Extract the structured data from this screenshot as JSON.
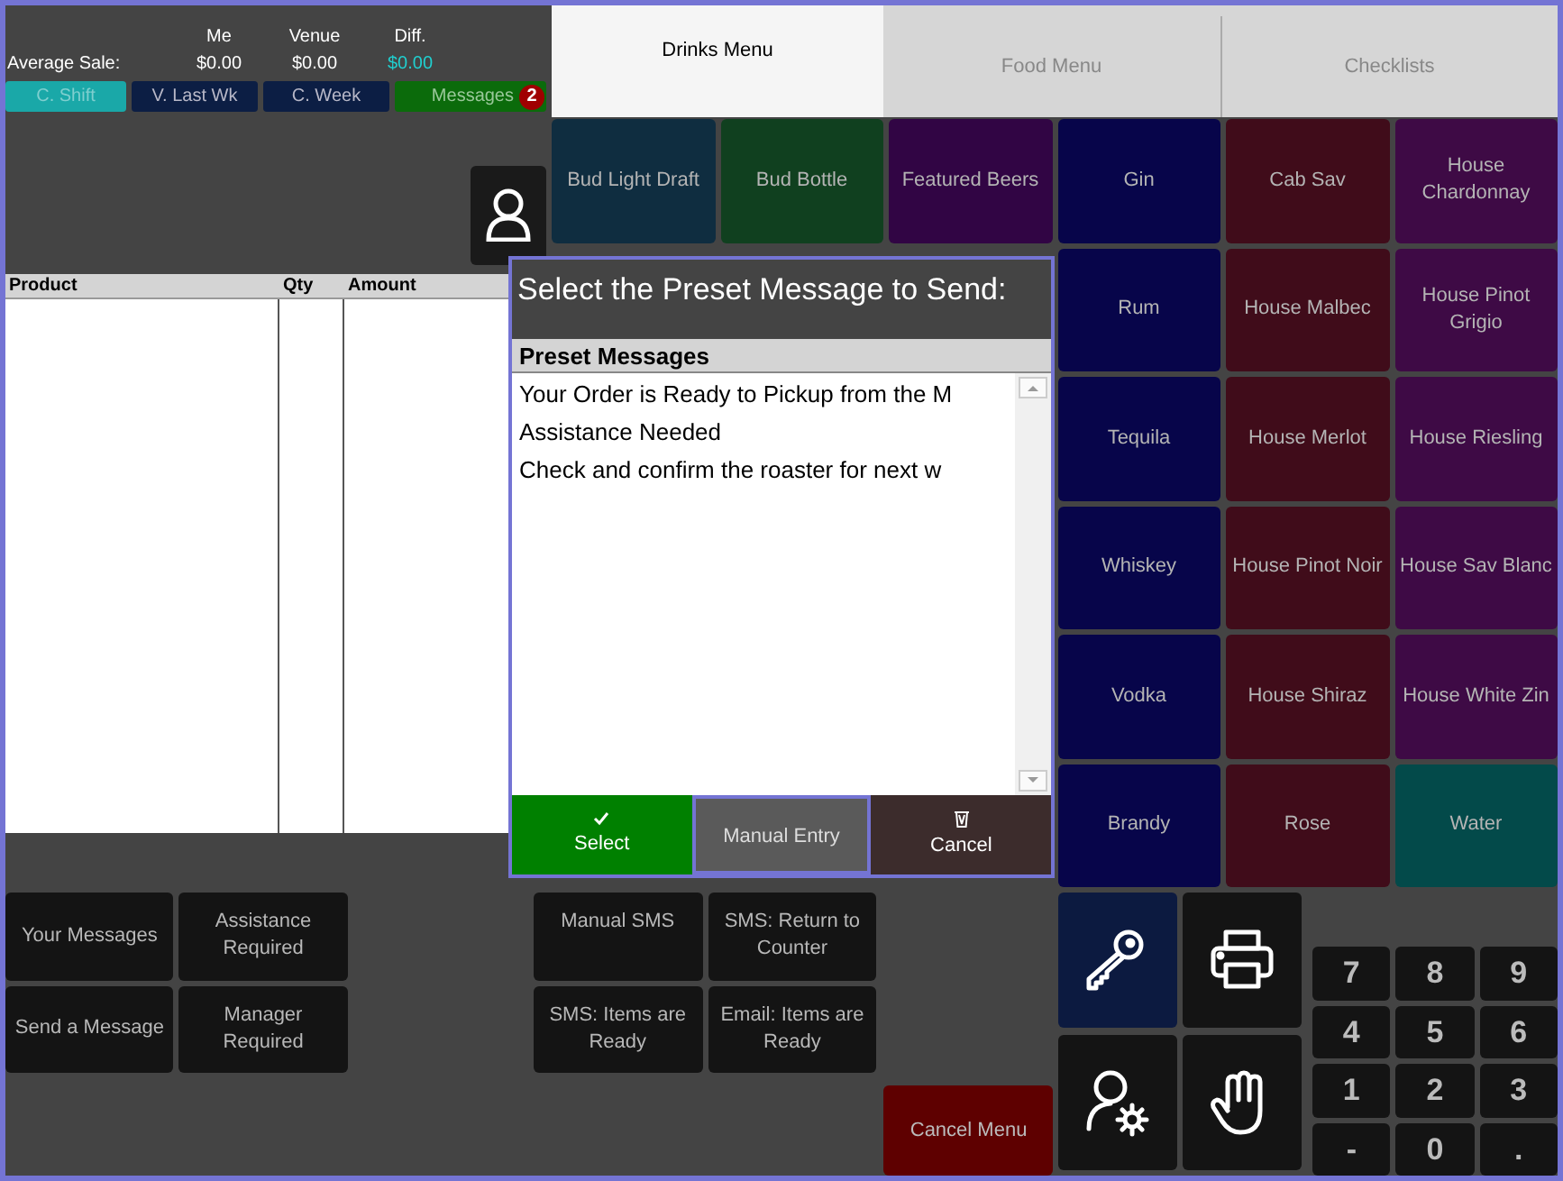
{
  "stats": {
    "label": "Average Sale:",
    "columns": [
      {
        "label": "Me",
        "value": "$0.00",
        "kind": "plain"
      },
      {
        "label": "Venue",
        "value": "$0.00",
        "kind": "plain"
      },
      {
        "label": "Diff.",
        "value": "$0.00",
        "kind": "diff"
      }
    ]
  },
  "period_buttons": [
    {
      "label": "C. Shift",
      "selected": true
    },
    {
      "label": "V. Last Wk",
      "selected": false
    },
    {
      "label": "C. Week",
      "selected": false
    }
  ],
  "messages_button": {
    "label": "Messages",
    "badge": "2"
  },
  "order_table": {
    "columns": [
      "Product",
      "Qty",
      "Amount"
    ]
  },
  "tabs": [
    {
      "label": "Drinks Menu",
      "selected": true
    },
    {
      "label": "Food Menu",
      "selected": false
    },
    {
      "label": "Checklists",
      "selected": false
    }
  ],
  "menu_items": [
    {
      "label": "Bud Light Draft",
      "color": "#0f2d40"
    },
    {
      "label": "Bud Bottle",
      "color": "#10401f"
    },
    {
      "label": "Featured Beers",
      "color": "#310544"
    },
    {
      "label": "Gin",
      "color": "#07054a"
    },
    {
      "label": "Cab Sav",
      "color": "#400c1a"
    },
    {
      "label": "House Chardonnay",
      "color": "#3e0a45"
    },
    {
      "label": "Rum",
      "color": "#07054a"
    },
    {
      "label": "House Malbec",
      "color": "#400c1a"
    },
    {
      "label": "House Pinot Grigio",
      "color": "#3e0a45"
    },
    {
      "label": "Tequila",
      "color": "#07054a"
    },
    {
      "label": "House Merlot",
      "color": "#400c1a"
    },
    {
      "label": "House Riesling",
      "color": "#3e0a45"
    },
    {
      "label": "Whiskey",
      "color": "#07054a"
    },
    {
      "label": "House Pinot Noir",
      "color": "#400c1a"
    },
    {
      "label": "House Sav Blanc",
      "color": "#3e0a45"
    },
    {
      "label": "Vodka",
      "color": "#07054a"
    },
    {
      "label": "House Shiraz",
      "color": "#400c1a"
    },
    {
      "label": "House White Zin",
      "color": "#3e0a45"
    },
    {
      "label": "Brandy",
      "color": "#07054a"
    },
    {
      "label": "Rose",
      "color": "#400c1a"
    },
    {
      "label": "Water",
      "color": "#034a4a"
    }
  ],
  "dialog": {
    "title": "Select the Preset Message to Send:",
    "list_header": "Preset Messages",
    "messages": [
      "Your Order is Ready to Pickup from the M",
      "Assistance Needed",
      "Check and confirm the roaster for next w"
    ],
    "buttons": [
      {
        "label": "Select",
        "kind": "select",
        "focused": false
      },
      {
        "label": "Manual Entry",
        "kind": "manual",
        "focused": true
      },
      {
        "label": "Cancel",
        "kind": "cancel",
        "focused": false
      }
    ]
  },
  "message_buttons": [
    "Your Messages",
    "Assistance Required",
    "Send a Message",
    "Manager Required"
  ],
  "sms_buttons": [
    "Manual SMS",
    "SMS: Return to Counter",
    "SMS: Items are Ready",
    "Email: Items are Ready"
  ],
  "cancel_menu": "Cancel Menu",
  "icon_buttons": [
    {
      "kind": "key",
      "active": true
    },
    {
      "kind": "printer",
      "active": false
    },
    {
      "kind": "user-settings",
      "active": false
    },
    {
      "kind": "hand",
      "active": false
    }
  ],
  "numpad": [
    "7",
    "8",
    "9",
    "4",
    "5",
    "6",
    "1",
    "2",
    "3",
    "-",
    "0",
    "."
  ]
}
